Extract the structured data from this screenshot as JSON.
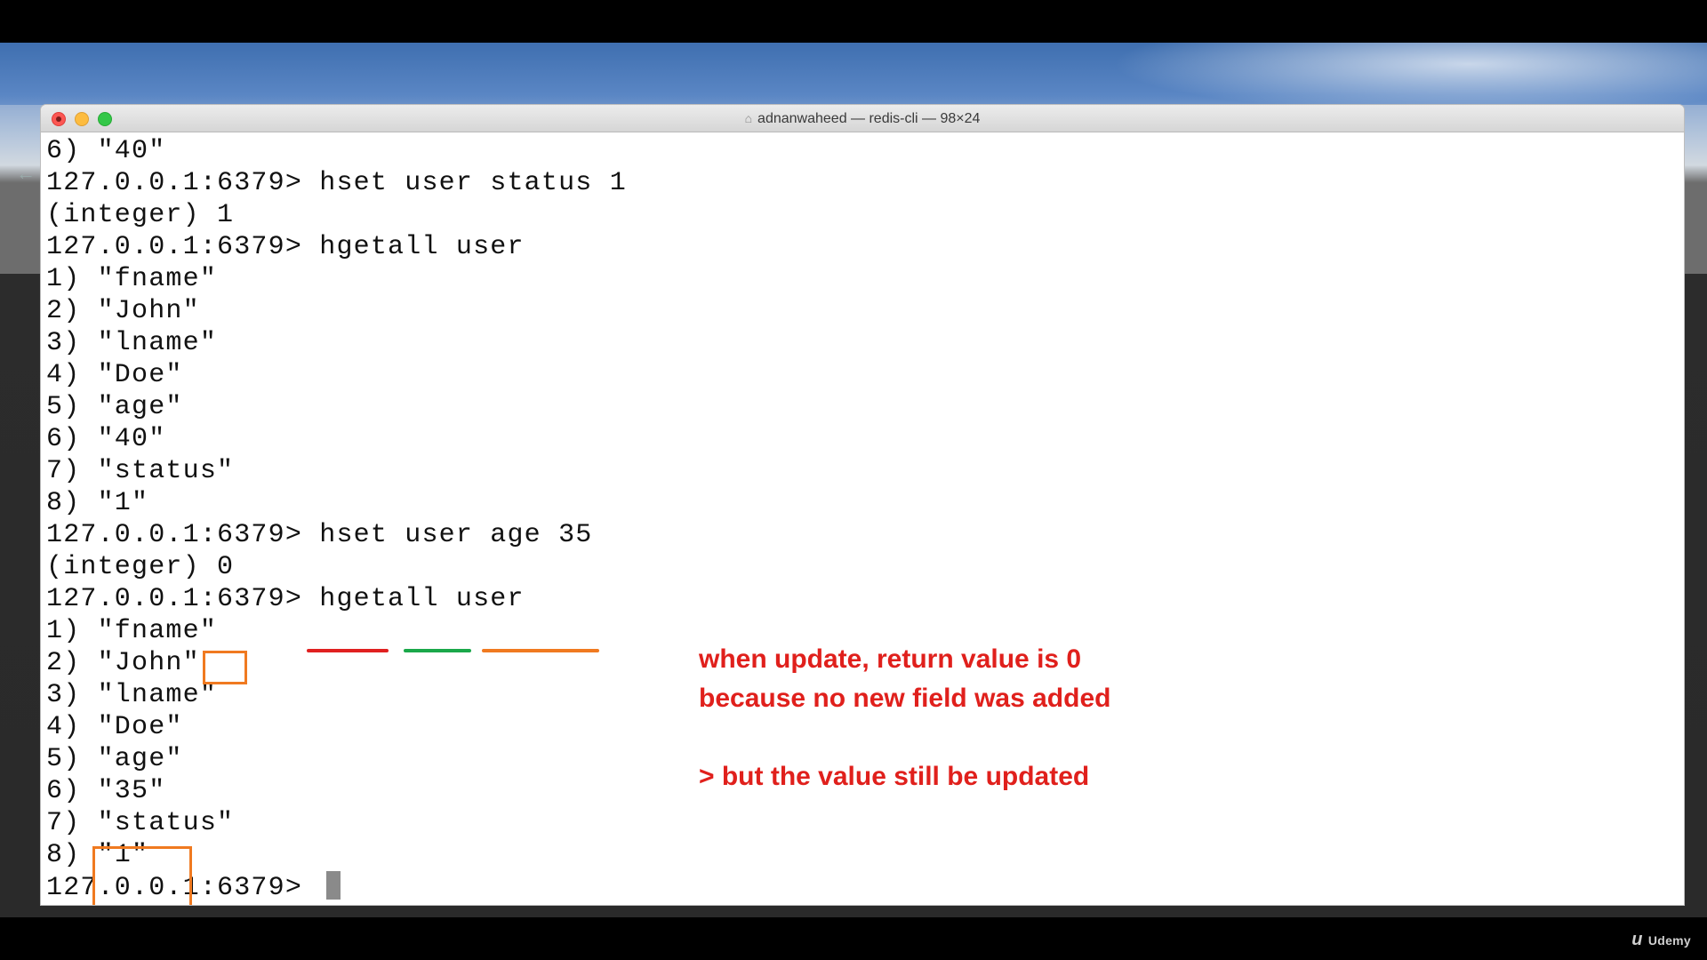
{
  "window": {
    "title": "adnanwaheed — redis-cli — 98×24",
    "title_icon": "home-icon"
  },
  "terminal": {
    "lines": [
      "6) \"40\"",
      "127.0.0.1:6379> hset user status 1",
      "(integer) 1",
      "127.0.0.1:6379> hgetall user",
      "1) \"fname\"",
      "2) \"John\"",
      "3) \"lname\"",
      "4) \"Doe\"",
      "5) \"age\"",
      "6) \"40\"",
      "7) \"status\"",
      "8) \"1\"",
      "127.0.0.1:6379> hset user age 35",
      "(integer) 0",
      "127.0.0.1:6379> hgetall user",
      "1) \"fname\"",
      "2) \"John\"",
      "3) \"lname\"",
      "4) \"Doe\"",
      "5) \"age\"",
      "6) \"35\"",
      "7) \"status\"",
      "8) \"1\"",
      "127.0.0.1:6379> "
    ]
  },
  "annotations": {
    "note_line1": "when update, return value is 0",
    "note_line2": "because no new field was added",
    "note_line3": "> but the value still be updated",
    "accent_red": "#e0201c",
    "accent_green": "#1aa84a",
    "accent_orange": "#f07a20"
  },
  "branding": {
    "label": "Udemy",
    "glyph": "u"
  }
}
